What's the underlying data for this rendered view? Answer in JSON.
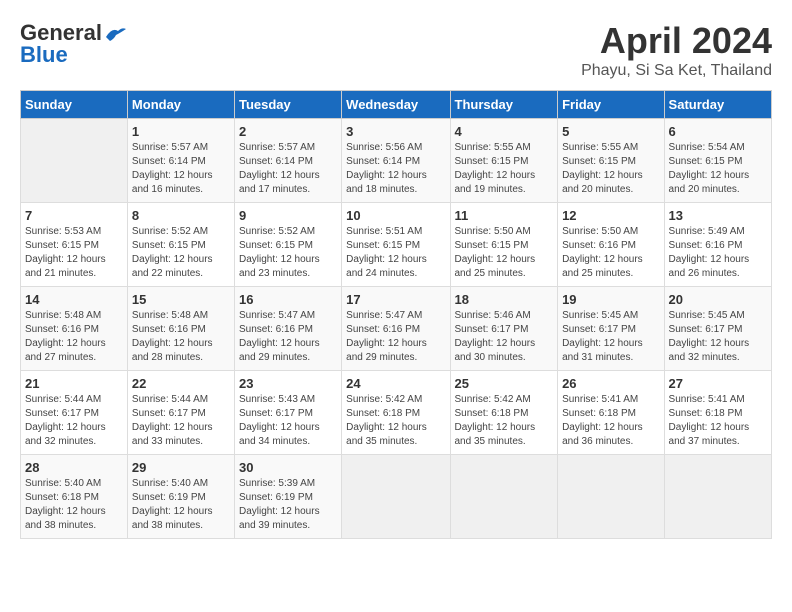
{
  "header": {
    "logo_line1": "General",
    "logo_line2": "Blue",
    "title": "April 2024",
    "subtitle": "Phayu, Si Sa Ket, Thailand"
  },
  "calendar": {
    "days_of_week": [
      "Sunday",
      "Monday",
      "Tuesday",
      "Wednesday",
      "Thursday",
      "Friday",
      "Saturday"
    ],
    "weeks": [
      [
        {
          "day": "",
          "info": ""
        },
        {
          "day": "1",
          "info": "Sunrise: 5:57 AM\nSunset: 6:14 PM\nDaylight: 12 hours\nand 16 minutes."
        },
        {
          "day": "2",
          "info": "Sunrise: 5:57 AM\nSunset: 6:14 PM\nDaylight: 12 hours\nand 17 minutes."
        },
        {
          "day": "3",
          "info": "Sunrise: 5:56 AM\nSunset: 6:14 PM\nDaylight: 12 hours\nand 18 minutes."
        },
        {
          "day": "4",
          "info": "Sunrise: 5:55 AM\nSunset: 6:15 PM\nDaylight: 12 hours\nand 19 minutes."
        },
        {
          "day": "5",
          "info": "Sunrise: 5:55 AM\nSunset: 6:15 PM\nDaylight: 12 hours\nand 20 minutes."
        },
        {
          "day": "6",
          "info": "Sunrise: 5:54 AM\nSunset: 6:15 PM\nDaylight: 12 hours\nand 20 minutes."
        }
      ],
      [
        {
          "day": "7",
          "info": "Sunrise: 5:53 AM\nSunset: 6:15 PM\nDaylight: 12 hours\nand 21 minutes."
        },
        {
          "day": "8",
          "info": "Sunrise: 5:52 AM\nSunset: 6:15 PM\nDaylight: 12 hours\nand 22 minutes."
        },
        {
          "day": "9",
          "info": "Sunrise: 5:52 AM\nSunset: 6:15 PM\nDaylight: 12 hours\nand 23 minutes."
        },
        {
          "day": "10",
          "info": "Sunrise: 5:51 AM\nSunset: 6:15 PM\nDaylight: 12 hours\nand 24 minutes."
        },
        {
          "day": "11",
          "info": "Sunrise: 5:50 AM\nSunset: 6:15 PM\nDaylight: 12 hours\nand 25 minutes."
        },
        {
          "day": "12",
          "info": "Sunrise: 5:50 AM\nSunset: 6:16 PM\nDaylight: 12 hours\nand 25 minutes."
        },
        {
          "day": "13",
          "info": "Sunrise: 5:49 AM\nSunset: 6:16 PM\nDaylight: 12 hours\nand 26 minutes."
        }
      ],
      [
        {
          "day": "14",
          "info": "Sunrise: 5:48 AM\nSunset: 6:16 PM\nDaylight: 12 hours\nand 27 minutes."
        },
        {
          "day": "15",
          "info": "Sunrise: 5:48 AM\nSunset: 6:16 PM\nDaylight: 12 hours\nand 28 minutes."
        },
        {
          "day": "16",
          "info": "Sunrise: 5:47 AM\nSunset: 6:16 PM\nDaylight: 12 hours\nand 29 minutes."
        },
        {
          "day": "17",
          "info": "Sunrise: 5:47 AM\nSunset: 6:16 PM\nDaylight: 12 hours\nand 29 minutes."
        },
        {
          "day": "18",
          "info": "Sunrise: 5:46 AM\nSunset: 6:17 PM\nDaylight: 12 hours\nand 30 minutes."
        },
        {
          "day": "19",
          "info": "Sunrise: 5:45 AM\nSunset: 6:17 PM\nDaylight: 12 hours\nand 31 minutes."
        },
        {
          "day": "20",
          "info": "Sunrise: 5:45 AM\nSunset: 6:17 PM\nDaylight: 12 hours\nand 32 minutes."
        }
      ],
      [
        {
          "day": "21",
          "info": "Sunrise: 5:44 AM\nSunset: 6:17 PM\nDaylight: 12 hours\nand 32 minutes."
        },
        {
          "day": "22",
          "info": "Sunrise: 5:44 AM\nSunset: 6:17 PM\nDaylight: 12 hours\nand 33 minutes."
        },
        {
          "day": "23",
          "info": "Sunrise: 5:43 AM\nSunset: 6:17 PM\nDaylight: 12 hours\nand 34 minutes."
        },
        {
          "day": "24",
          "info": "Sunrise: 5:42 AM\nSunset: 6:18 PM\nDaylight: 12 hours\nand 35 minutes."
        },
        {
          "day": "25",
          "info": "Sunrise: 5:42 AM\nSunset: 6:18 PM\nDaylight: 12 hours\nand 35 minutes."
        },
        {
          "day": "26",
          "info": "Sunrise: 5:41 AM\nSunset: 6:18 PM\nDaylight: 12 hours\nand 36 minutes."
        },
        {
          "day": "27",
          "info": "Sunrise: 5:41 AM\nSunset: 6:18 PM\nDaylight: 12 hours\nand 37 minutes."
        }
      ],
      [
        {
          "day": "28",
          "info": "Sunrise: 5:40 AM\nSunset: 6:18 PM\nDaylight: 12 hours\nand 38 minutes."
        },
        {
          "day": "29",
          "info": "Sunrise: 5:40 AM\nSunset: 6:19 PM\nDaylight: 12 hours\nand 38 minutes."
        },
        {
          "day": "30",
          "info": "Sunrise: 5:39 AM\nSunset: 6:19 PM\nDaylight: 12 hours\nand 39 minutes."
        },
        {
          "day": "",
          "info": ""
        },
        {
          "day": "",
          "info": ""
        },
        {
          "day": "",
          "info": ""
        },
        {
          "day": "",
          "info": ""
        }
      ]
    ]
  }
}
